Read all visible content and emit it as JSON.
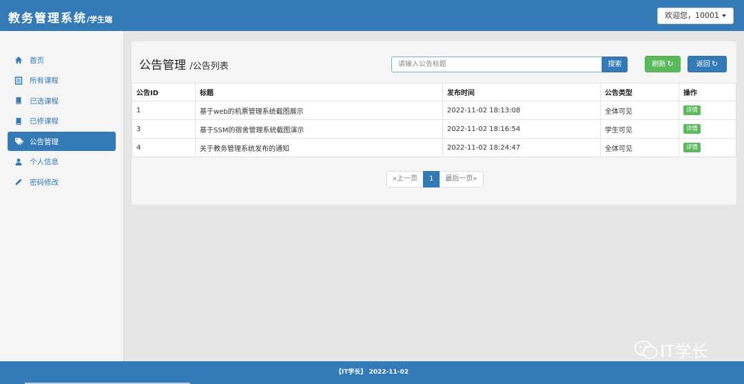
{
  "header": {
    "brand": "教务管理系统",
    "brand_sub": "/学生端",
    "user_menu": "欢迎您，10001"
  },
  "sidebar": {
    "items": [
      {
        "label": "首页",
        "icon": "home-icon",
        "active": false
      },
      {
        "label": "所有课程",
        "icon": "list-icon",
        "active": false
      },
      {
        "label": "已选课程",
        "icon": "book-icon",
        "active": false
      },
      {
        "label": "已修课程",
        "icon": "book-icon",
        "active": false
      },
      {
        "label": "公告管理",
        "icon": "tags-icon",
        "active": true
      },
      {
        "label": "个人信息",
        "icon": "user-icon",
        "active": false
      },
      {
        "label": "密码修改",
        "icon": "pencil-icon",
        "active": false
      }
    ]
  },
  "main": {
    "title": "公告管理",
    "subtitle": "/公告列表",
    "search_placeholder": "请输入公告标题",
    "search_label": "搜索",
    "refresh_label": "刷新",
    "back_label": "返回",
    "table": {
      "columns": [
        "公告ID",
        "标题",
        "发布时间",
        "公告类型",
        "操作"
      ],
      "rows": [
        {
          "id": "1",
          "title": "基于web的机票管理系统截图展示",
          "time": "2022-11-02 18:13:08",
          "type": "全体可见",
          "action": "详情"
        },
        {
          "id": "3",
          "title": "基于SSM的宿舍管理系统截图演示",
          "time": "2022-11-02 18:16:54",
          "type": "学生可见",
          "action": "详情"
        },
        {
          "id": "4",
          "title": "关于教务管理系统发布的通知",
          "time": "2022-11-02 18:24:47",
          "type": "全体可见",
          "action": "详情"
        }
      ]
    },
    "pagination": {
      "prev": "«上一页",
      "current": "1",
      "last": "最后一页»"
    }
  },
  "watermark": "IT学长",
  "footer": {
    "text": "【IT学长】 2022-11-02"
  },
  "colors": {
    "primary": "#337ab7",
    "success": "#5cb85c",
    "background": "#e6e6e6"
  }
}
